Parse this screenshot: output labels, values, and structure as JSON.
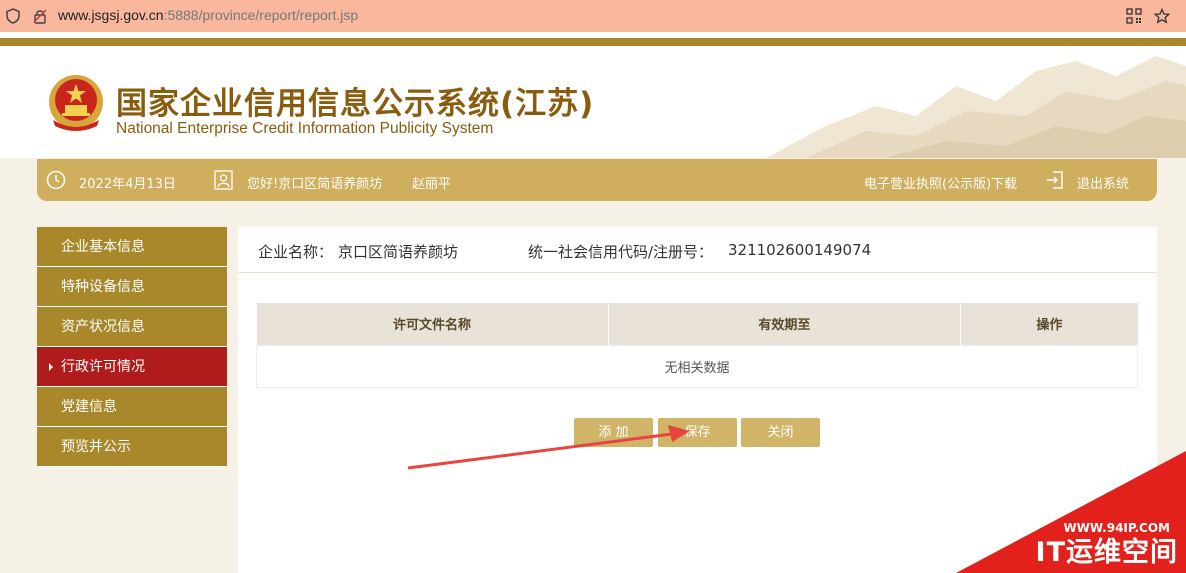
{
  "browser": {
    "url_host": "www.jsgsj.gov.cn",
    "url_rest": ":5888/province/report/report.jsp"
  },
  "header": {
    "title_cn": "国家企业信用信息公示系统(江苏)",
    "title_en": "National Enterprise Credit Information Publicity System"
  },
  "infobar": {
    "date": "2022年4月13日",
    "greeting": "您好!京口区简语养颜坊",
    "user": "赵丽平",
    "download": "电子营业执照(公示版)下载",
    "logout": "退出系统"
  },
  "sidebar": {
    "items": [
      {
        "label": "企业基本信息"
      },
      {
        "label": "特种设备信息"
      },
      {
        "label": "资产状况信息"
      },
      {
        "label": "行政许可情况"
      },
      {
        "label": "党建信息"
      },
      {
        "label": "预览并公示"
      }
    ]
  },
  "company": {
    "name_label": "企业名称：",
    "name": "京口区简语养颜坊",
    "code_label": "统一社会信用代码/注册号：",
    "code": "321102600149074"
  },
  "table": {
    "headers": [
      "许可文件名称",
      "有效期至",
      "操作"
    ],
    "empty": "无相关数据"
  },
  "buttons": {
    "add": "添 加",
    "save": "保存",
    "close": "关闭"
  },
  "watermark": {
    "url": "WWW.94IP.COM",
    "name": "IT运维空间"
  },
  "colors": {
    "gold": "#a8882b",
    "active": "#b01c1c",
    "infobar": "#cfae5d",
    "arrow": "#e8453c"
  }
}
